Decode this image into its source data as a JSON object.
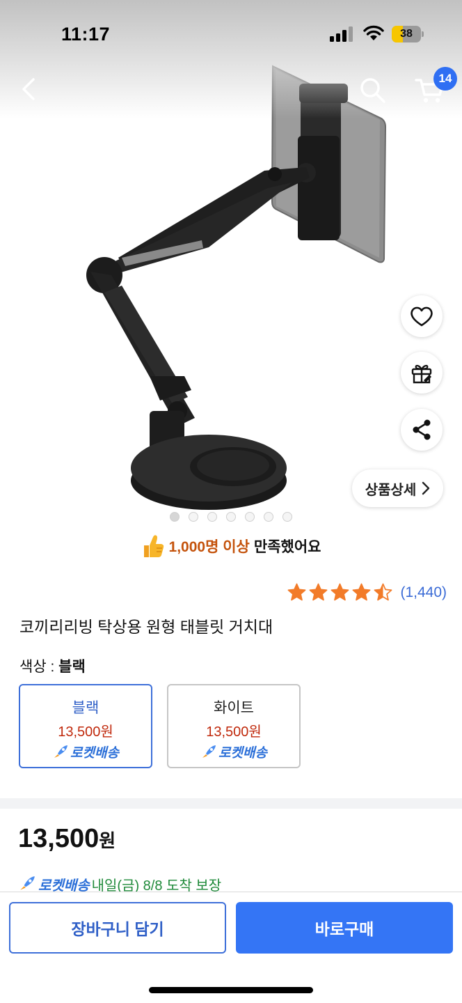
{
  "status_bar": {
    "time": "11:17",
    "battery": "38",
    "battery_level": 0.38
  },
  "nav": {
    "back_icon": "chevron-left-icon",
    "search_icon": "search-icon",
    "cart_icon": "cart-icon",
    "cart_count": "14"
  },
  "actions": {
    "wishlist_icon": "heart-icon",
    "gift_icon": "gift-icon",
    "share_icon": "share-icon",
    "detail_label": "상품상세"
  },
  "carousel": {
    "total": 7,
    "active_index": 0
  },
  "satisfaction": {
    "highlight": "1,000명 이상",
    "rest": "만족했어요"
  },
  "rating": {
    "stars": 4.5,
    "count": "(1,440)"
  },
  "product": {
    "title": "코끼리리빙 탁상용 원형 태블릿 거치대"
  },
  "option": {
    "label": "색상 :",
    "selected": "블랙",
    "choices": [
      {
        "name": "블랙",
        "price": "13,500원",
        "delivery": "로켓배송"
      },
      {
        "name": "화이트",
        "price": "13,500원",
        "delivery": "로켓배송"
      }
    ]
  },
  "price": {
    "amount": "13,500",
    "unit": "원"
  },
  "delivery": {
    "badge": "로켓배송",
    "text": "내일(금) 8/8 도착 보장"
  },
  "bottom_bar": {
    "cart_button": "장바구니 담기",
    "buy_button": "바로구매"
  },
  "colors": {
    "accent": "#3475f5",
    "price_red": "#c0290c",
    "star": "#f27b29",
    "delivery_green": "#1f8a3a",
    "satisfaction_orange": "#c4520b"
  }
}
